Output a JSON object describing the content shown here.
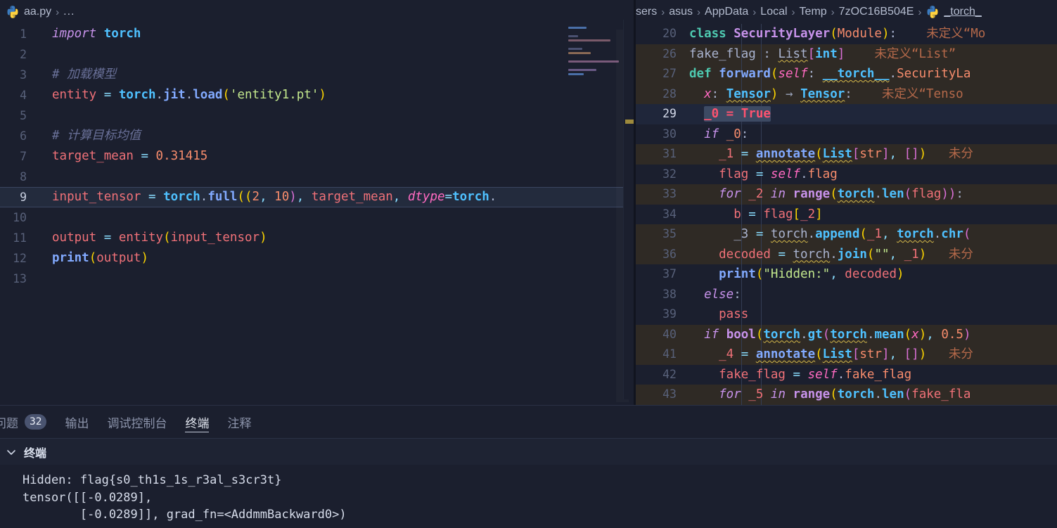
{
  "left_editor": {
    "breadcrumb": {
      "icon": "python-file-icon",
      "file": "aa.py",
      "separator": "›",
      "dots": "..."
    },
    "lines": [
      {
        "n": "1",
        "tokens": [
          {
            "t": "import",
            "c": "t-kw"
          },
          {
            "t": " ",
            "c": "t-plain"
          },
          {
            "t": "torch",
            "c": "t-type"
          }
        ]
      },
      {
        "n": "2",
        "tokens": []
      },
      {
        "n": "3",
        "tokens": [
          {
            "t": "# 加载模型",
            "c": "t-cmt"
          }
        ]
      },
      {
        "n": "4",
        "tokens": [
          {
            "t": "entity",
            "c": "t-var"
          },
          {
            "t": " ",
            "c": ""
          },
          {
            "t": "=",
            "c": "t-op"
          },
          {
            "t": " ",
            "c": ""
          },
          {
            "t": "torch",
            "c": "t-type"
          },
          {
            "t": ".",
            "c": "t-plain"
          },
          {
            "t": "jit",
            "c": "t-fn"
          },
          {
            "t": ".",
            "c": "t-plain"
          },
          {
            "t": "load",
            "c": "t-fn"
          },
          {
            "t": "(",
            "c": "t-paren1"
          },
          {
            "t": "'entity1.pt'",
            "c": "t-str"
          },
          {
            "t": ")",
            "c": "t-paren1"
          }
        ]
      },
      {
        "n": "5",
        "tokens": []
      },
      {
        "n": "6",
        "tokens": [
          {
            "t": "# 计算目标均值",
            "c": "t-cmt"
          }
        ]
      },
      {
        "n": "7",
        "tokens": [
          {
            "t": "target_mean",
            "c": "t-var"
          },
          {
            "t": " ",
            "c": ""
          },
          {
            "t": "=",
            "c": "t-op"
          },
          {
            "t": " ",
            "c": ""
          },
          {
            "t": "0.31415",
            "c": "t-num"
          }
        ]
      },
      {
        "n": "8",
        "tokens": []
      },
      {
        "n": "9",
        "highlight": true,
        "tokens": [
          {
            "t": "input_tensor",
            "c": "t-var"
          },
          {
            "t": " ",
            "c": ""
          },
          {
            "t": "=",
            "c": "t-op"
          },
          {
            "t": " ",
            "c": ""
          },
          {
            "t": "torch",
            "c": "t-type"
          },
          {
            "t": ".",
            "c": "t-plain"
          },
          {
            "t": "full",
            "c": "t-fn"
          },
          {
            "t": "((",
            "c": "t-paren1"
          },
          {
            "t": "2",
            "c": "t-num"
          },
          {
            "t": ", ",
            "c": "t-punct"
          },
          {
            "t": "10",
            "c": "t-num"
          },
          {
            "t": ")",
            "c": "t-paren2"
          },
          {
            "t": ", ",
            "c": "t-punct"
          },
          {
            "t": "target_mean",
            "c": "t-var"
          },
          {
            "t": ", ",
            "c": "t-punct"
          },
          {
            "t": "dtype",
            "c": "t-self"
          },
          {
            "t": "=",
            "c": "t-op"
          },
          {
            "t": "torch",
            "c": "t-type"
          },
          {
            "t": ".",
            "c": "t-plain"
          }
        ]
      },
      {
        "n": "10",
        "tokens": []
      },
      {
        "n": "11",
        "tokens": [
          {
            "t": "output",
            "c": "t-var"
          },
          {
            "t": " ",
            "c": ""
          },
          {
            "t": "=",
            "c": "t-op"
          },
          {
            "t": " ",
            "c": ""
          },
          {
            "t": "entity",
            "c": "t-var"
          },
          {
            "t": "(",
            "c": "t-paren1"
          },
          {
            "t": "input_tensor",
            "c": "t-var"
          },
          {
            "t": ")",
            "c": "t-paren1"
          }
        ]
      },
      {
        "n": "12",
        "tokens": [
          {
            "t": "print",
            "c": "t-fn"
          },
          {
            "t": "(",
            "c": "t-paren1"
          },
          {
            "t": "output",
            "c": "t-var"
          },
          {
            "t": ")",
            "c": "t-paren1"
          }
        ]
      },
      {
        "n": "13",
        "tokens": []
      }
    ],
    "minimap_name": "minimap",
    "overview_ruler_name": "overview-ruler"
  },
  "right_editor": {
    "breadcrumb": {
      "crumbs": [
        "sers",
        "asus",
        "AppData",
        "Local",
        "Temp",
        "7zOC16B504E"
      ],
      "separator": "›",
      "icon": "python-file-icon",
      "file": "_torch_"
    },
    "lines": [
      {
        "n": "20",
        "bg": "",
        "tokens": [
          {
            "t": "class ",
            "c": "t-def"
          },
          {
            "t": "SecurityLayer",
            "c": "t-class"
          },
          {
            "t": "(",
            "c": "t-paren1"
          },
          {
            "t": "Module",
            "c": "t-num"
          },
          {
            "t": ")",
            "c": "t-paren1"
          },
          {
            "t": ":",
            "c": "t-plain"
          },
          {
            "t": "    ",
            "c": ""
          },
          {
            "t": "未定义“Mo",
            "c": "t-err"
          }
        ]
      },
      {
        "n": "26",
        "bg": "row-dim",
        "tokens": [
          {
            "t": "fake_flag",
            "c": "t-plain"
          },
          {
            "t": " : ",
            "c": "t-plain"
          },
          {
            "t": "List",
            "c": "t-plain squig"
          },
          {
            "t": "[",
            "c": "t-paren2"
          },
          {
            "t": "int",
            "c": "t-type"
          },
          {
            "t": "]",
            "c": "t-paren2"
          },
          {
            "t": "    ",
            "c": ""
          },
          {
            "t": "未定义“List”",
            "c": "t-err"
          }
        ]
      },
      {
        "n": "27",
        "bg": "row-dim",
        "tokens": [
          {
            "t": "def ",
            "c": "t-def"
          },
          {
            "t": "forward",
            "c": "t-fn"
          },
          {
            "t": "(",
            "c": "t-paren1"
          },
          {
            "t": "self",
            "c": "t-self"
          },
          {
            "t": ": ",
            "c": "t-plain"
          },
          {
            "t": "__torch__",
            "c": "t-type squig"
          },
          {
            "t": ".",
            "c": "t-plain"
          },
          {
            "t": "SecurityLa",
            "c": "t-num"
          }
        ]
      },
      {
        "n": "28",
        "bg": "row-dim",
        "tokens": [
          {
            "t": "  x",
            "c": "t-self"
          },
          {
            "t": ": ",
            "c": "t-plain"
          },
          {
            "t": "Tensor",
            "c": "t-type squig"
          },
          {
            "t": ")",
            "c": "t-paren1"
          },
          {
            "t": " → ",
            "c": "t-arrow"
          },
          {
            "t": "Tensor",
            "c": "t-type squig"
          },
          {
            "t": ":",
            "c": "t-plain"
          },
          {
            "t": "    ",
            "c": ""
          },
          {
            "t": "未定义“Tenso",
            "c": "t-err"
          }
        ]
      },
      {
        "n": "29",
        "bg": "row-cur",
        "cur": true,
        "bulb": true,
        "tokens": [
          {
            "t": "  ",
            "c": ""
          },
          {
            "t": "_0 = True",
            "c": "t-true sel-token"
          }
        ]
      },
      {
        "n": "30",
        "bg": "",
        "tokens": [
          {
            "t": "  if ",
            "c": "t-kw"
          },
          {
            "t": "_0",
            "c": "t-num"
          },
          {
            "t": ":",
            "c": "t-plain"
          }
        ]
      },
      {
        "n": "31",
        "bg": "row-dim",
        "tokens": [
          {
            "t": "    _1",
            "c": "t-var"
          },
          {
            "t": " = ",
            "c": "t-op"
          },
          {
            "t": "annotate",
            "c": "t-fn squig"
          },
          {
            "t": "(",
            "c": "t-paren1"
          },
          {
            "t": "List",
            "c": "t-type squig"
          },
          {
            "t": "[",
            "c": "t-paren2"
          },
          {
            "t": "str",
            "c": "t-num"
          },
          {
            "t": "]",
            "c": "t-paren2"
          },
          {
            "t": ", ",
            "c": "t-punct"
          },
          {
            "t": "[]",
            "c": "t-paren2"
          },
          {
            "t": ")",
            "c": "t-paren1"
          },
          {
            "t": "   ",
            "c": ""
          },
          {
            "t": "未分",
            "c": "t-err"
          }
        ]
      },
      {
        "n": "32",
        "bg": "",
        "tokens": [
          {
            "t": "    flag",
            "c": "t-var"
          },
          {
            "t": " = ",
            "c": "t-op"
          },
          {
            "t": "self",
            "c": "t-self"
          },
          {
            "t": ".",
            "c": "t-plain"
          },
          {
            "t": "flag",
            "c": "t-num"
          }
        ]
      },
      {
        "n": "33",
        "bg": "row-dim",
        "tokens": [
          {
            "t": "    for ",
            "c": "t-kw"
          },
          {
            "t": "_2",
            "c": "t-var"
          },
          {
            "t": " in ",
            "c": "t-kw"
          },
          {
            "t": "range",
            "c": "t-class"
          },
          {
            "t": "(",
            "c": "t-paren1"
          },
          {
            "t": "torch",
            "c": "t-type squig"
          },
          {
            "t": ".",
            "c": "t-plain"
          },
          {
            "t": "len",
            "c": "t-type"
          },
          {
            "t": "(",
            "c": "t-paren2"
          },
          {
            "t": "flag",
            "c": "t-var"
          },
          {
            "t": "))",
            "c": "t-paren2"
          },
          {
            "t": ":",
            "c": "t-plain"
          }
        ]
      },
      {
        "n": "34",
        "bg": "",
        "tokens": [
          {
            "t": "      b",
            "c": "t-var"
          },
          {
            "t": " = ",
            "c": "t-op"
          },
          {
            "t": "flag",
            "c": "t-var"
          },
          {
            "t": "[",
            "c": "t-paren1"
          },
          {
            "t": "_2",
            "c": "t-var"
          },
          {
            "t": "]",
            "c": "t-paren1"
          }
        ]
      },
      {
        "n": "35",
        "bg": "row-dim",
        "tokens": [
          {
            "t": "      _3",
            "c": "t-plain"
          },
          {
            "t": " = ",
            "c": "t-op"
          },
          {
            "t": "torch",
            "c": "t-plain squig"
          },
          {
            "t": ".",
            "c": "t-plain"
          },
          {
            "t": "append",
            "c": "t-type"
          },
          {
            "t": "(",
            "c": "t-paren1"
          },
          {
            "t": "_1",
            "c": "t-var"
          },
          {
            "t": ", ",
            "c": "t-punct"
          },
          {
            "t": "torch",
            "c": "t-type squig"
          },
          {
            "t": ".",
            "c": "t-plain"
          },
          {
            "t": "chr",
            "c": "t-type"
          },
          {
            "t": "(",
            "c": "t-paren2"
          }
        ]
      },
      {
        "n": "36",
        "bg": "row-dim",
        "tokens": [
          {
            "t": "    decoded",
            "c": "t-var"
          },
          {
            "t": " = ",
            "c": "t-op"
          },
          {
            "t": "torch",
            "c": "t-plain squig"
          },
          {
            "t": ".",
            "c": "t-plain"
          },
          {
            "t": "join",
            "c": "t-type"
          },
          {
            "t": "(",
            "c": "t-paren1"
          },
          {
            "t": "\"\"",
            "c": "t-str"
          },
          {
            "t": ", ",
            "c": "t-punct"
          },
          {
            "t": "_1",
            "c": "t-var"
          },
          {
            "t": ")",
            "c": "t-paren1"
          },
          {
            "t": "   ",
            "c": ""
          },
          {
            "t": "未分",
            "c": "t-err"
          }
        ]
      },
      {
        "n": "37",
        "bg": "",
        "tokens": [
          {
            "t": "    print",
            "c": "t-fn"
          },
          {
            "t": "(",
            "c": "t-paren1"
          },
          {
            "t": "\"Hidden:\"",
            "c": "t-str"
          },
          {
            "t": ", ",
            "c": "t-punct"
          },
          {
            "t": "decoded",
            "c": "t-var"
          },
          {
            "t": ")",
            "c": "t-paren1"
          }
        ]
      },
      {
        "n": "38",
        "bg": "",
        "tokens": [
          {
            "t": "  else",
            "c": "t-kw"
          },
          {
            "t": ":",
            "c": "t-plain"
          }
        ]
      },
      {
        "n": "39",
        "bg": "",
        "tokens": [
          {
            "t": "    pass",
            "c": "t-var"
          }
        ]
      },
      {
        "n": "40",
        "bg": "row-dim",
        "tokens": [
          {
            "t": "  if ",
            "c": "t-kw"
          },
          {
            "t": "bool",
            "c": "t-class"
          },
          {
            "t": "(",
            "c": "t-paren1"
          },
          {
            "t": "torch",
            "c": "t-type squig"
          },
          {
            "t": ".",
            "c": "t-plain"
          },
          {
            "t": "gt",
            "c": "t-type"
          },
          {
            "t": "(",
            "c": "t-paren2"
          },
          {
            "t": "torch",
            "c": "t-type squig"
          },
          {
            "t": ".",
            "c": "t-plain"
          },
          {
            "t": "mean",
            "c": "t-type"
          },
          {
            "t": "(",
            "c": "t-paren1"
          },
          {
            "t": "x",
            "c": "t-self"
          },
          {
            "t": ")",
            "c": "t-paren1"
          },
          {
            "t": ", ",
            "c": "t-punct"
          },
          {
            "t": "0.5",
            "c": "t-num"
          },
          {
            "t": ")",
            "c": "t-paren2"
          }
        ]
      },
      {
        "n": "41",
        "bg": "row-dim",
        "tokens": [
          {
            "t": "    _4",
            "c": "t-var"
          },
          {
            "t": " = ",
            "c": "t-op"
          },
          {
            "t": "annotate",
            "c": "t-fn squig"
          },
          {
            "t": "(",
            "c": "t-paren1"
          },
          {
            "t": "List",
            "c": "t-type squig"
          },
          {
            "t": "[",
            "c": "t-paren2"
          },
          {
            "t": "str",
            "c": "t-num"
          },
          {
            "t": "]",
            "c": "t-paren2"
          },
          {
            "t": ", ",
            "c": "t-punct"
          },
          {
            "t": "[]",
            "c": "t-paren2"
          },
          {
            "t": ")",
            "c": "t-paren1"
          },
          {
            "t": "   ",
            "c": ""
          },
          {
            "t": "未分",
            "c": "t-err"
          }
        ]
      },
      {
        "n": "42",
        "bg": "",
        "tokens": [
          {
            "t": "    fake_flag",
            "c": "t-var"
          },
          {
            "t": " = ",
            "c": "t-op"
          },
          {
            "t": "self",
            "c": "t-self"
          },
          {
            "t": ".",
            "c": "t-plain"
          },
          {
            "t": "fake_flag",
            "c": "t-num"
          }
        ]
      },
      {
        "n": "43",
        "bg": "row-dim",
        "tokens": [
          {
            "t": "    for ",
            "c": "t-kw"
          },
          {
            "t": "_5",
            "c": "t-var"
          },
          {
            "t": " in ",
            "c": "t-kw"
          },
          {
            "t": "range",
            "c": "t-class"
          },
          {
            "t": "(",
            "c": "t-paren1"
          },
          {
            "t": "torch",
            "c": "t-type"
          },
          {
            "t": ".",
            "c": "t-plain"
          },
          {
            "t": "len",
            "c": "t-type"
          },
          {
            "t": "(",
            "c": "t-paren2"
          },
          {
            "t": "fake_fla",
            "c": "t-var"
          }
        ]
      }
    ]
  },
  "panel": {
    "tabs": [
      {
        "label": "问题",
        "badge": "32",
        "active": false,
        "name": "tab-problems"
      },
      {
        "label": "输出",
        "badge": "",
        "active": false,
        "name": "tab-output"
      },
      {
        "label": "调试控制台",
        "badge": "",
        "active": false,
        "name": "tab-debug-console"
      },
      {
        "label": "终端",
        "badge": "",
        "active": true,
        "name": "tab-terminal"
      },
      {
        "label": "注释",
        "badge": "",
        "active": false,
        "name": "tab-comments"
      }
    ],
    "terminal_header": "终端",
    "terminal_lines": [
      "Hidden: flag{s0_th1s_1s_r3al_s3cr3t}",
      "tensor([[-0.0289],",
      "        [-0.0289]], grad_fn=<AddmmBackward0>)"
    ]
  },
  "colors": {
    "editor_bg": "#1b1f2e",
    "accent": "#82aaff",
    "error": "#b5694a",
    "string": "#c3e88d",
    "highlight_line": "#232b3d"
  }
}
